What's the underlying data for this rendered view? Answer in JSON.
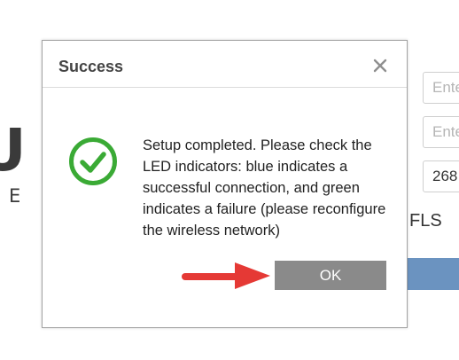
{
  "background": {
    "logo_big": "U",
    "logo_small": "EI",
    "input_1": "Ente",
    "input_2": "Ente",
    "input_3": "268",
    "fls_text": "FLS",
    "accent_blue": "#6b93c0"
  },
  "dialog": {
    "title": "Success",
    "close_icon": "close-icon",
    "status_icon": "check-circle-icon",
    "status_color": "#3aaa35",
    "message": "Setup completed. Please check the LED indicators: blue indicates a successful connection, and green indicates a failure (please reconfigure the wireless network)",
    "ok_label": "OK",
    "ok_color": "#8a8a8a"
  },
  "annotation": {
    "arrow_icon": "red-arrow-icon",
    "arrow_color": "#e53935"
  }
}
